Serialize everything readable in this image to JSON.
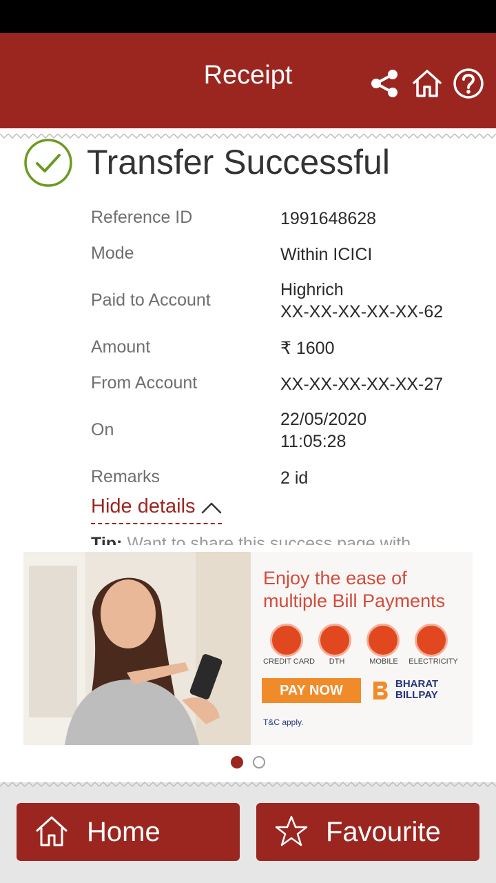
{
  "header": {
    "title": "Receipt",
    "icons": [
      "share-icon",
      "home-icon",
      "help-icon"
    ]
  },
  "status": {
    "title": "Transfer Successful",
    "icon": "check-circle-icon",
    "icon_color": "#6a9a1f"
  },
  "details": [
    {
      "label": "Reference ID",
      "value": "1991648628"
    },
    {
      "label": "Mode",
      "value": "Within ICICI"
    },
    {
      "label": "Paid to Account",
      "value_line1": "Highrich",
      "value_line2": "XX-XX-XX-XX-XX-62"
    },
    {
      "label": "Amount",
      "value": "₹ 1600"
    },
    {
      "label": "From Account",
      "value": "XX-XX-XX-XX-XX-27"
    },
    {
      "label": "On",
      "value_line1": "22/05/2020",
      "value_line2": "11:05:28"
    },
    {
      "label": "Remarks",
      "value": "2 id"
    }
  ],
  "hide_details": "Hide details",
  "tip": {
    "label": "Tip:",
    "text": "Want to share this success page with"
  },
  "banner": {
    "headline": "Enjoy the ease of multiple Bill Payments",
    "categories": [
      {
        "label": "CREDIT CARD",
        "icon": "credit-card-icon"
      },
      {
        "label": "DTH",
        "icon": "satellite-dish-icon"
      },
      {
        "label": "MOBILE",
        "icon": "mobile-phone-icon"
      },
      {
        "label": "ELECTRICITY",
        "icon": "lightning-icon"
      }
    ],
    "cta": "PAY NOW",
    "brand_line1": "BHARAT",
    "brand_line2": "BILLPAY",
    "tnc": "T&C apply."
  },
  "carousel": {
    "pages": 2,
    "active": 1
  },
  "footer": {
    "home_label": "Home",
    "favourite_label": "Favourite"
  },
  "colors": {
    "brand": "#9b2620",
    "footer_bg": "#e6e6e6"
  }
}
